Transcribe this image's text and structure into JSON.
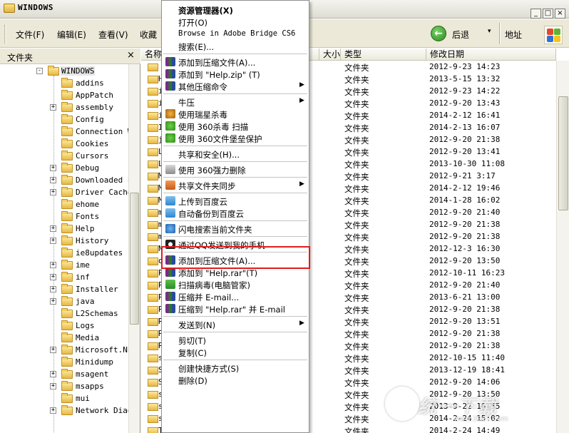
{
  "window": {
    "title": "WINDOWS",
    "minimize": "_",
    "maximize": "□",
    "close": "×"
  },
  "menubar": {
    "items": [
      "文件(F)",
      "编辑(E)",
      "查看(V)",
      "收藏"
    ],
    "back_label": "后退",
    "back_caret": "▾",
    "address_label": "地址"
  },
  "folders_pane": {
    "header": "文件夹",
    "close": "×",
    "root": "WINDOWS",
    "items": [
      {
        "name": "addins",
        "expander": ""
      },
      {
        "name": "AppPatch",
        "expander": ""
      },
      {
        "name": "assembly",
        "expander": "+"
      },
      {
        "name": "Config",
        "expander": ""
      },
      {
        "name": "Connection W",
        "expander": ""
      },
      {
        "name": "Cookies",
        "expander": ""
      },
      {
        "name": "Cursors",
        "expander": ""
      },
      {
        "name": "Debug",
        "expander": "+"
      },
      {
        "name": "Downloaded P",
        "expander": "+"
      },
      {
        "name": "Driver Cache",
        "expander": "+"
      },
      {
        "name": "ehome",
        "expander": ""
      },
      {
        "name": "Fonts",
        "expander": ""
      },
      {
        "name": "Help",
        "expander": "+"
      },
      {
        "name": "History",
        "expander": "+"
      },
      {
        "name": "ie8updates",
        "expander": ""
      },
      {
        "name": "ime",
        "expander": "+"
      },
      {
        "name": "inf",
        "expander": "+"
      },
      {
        "name": "Installer",
        "expander": "+"
      },
      {
        "name": "java",
        "expander": "+"
      },
      {
        "name": "L2Schemas",
        "expander": ""
      },
      {
        "name": "Logs",
        "expander": ""
      },
      {
        "name": "Media",
        "expander": ""
      },
      {
        "name": "Microsoft.NET",
        "expander": "+"
      },
      {
        "name": "Minidump",
        "expander": ""
      },
      {
        "name": "msagent",
        "expander": "+"
      },
      {
        "name": "msapps",
        "expander": "+"
      },
      {
        "name": "mui",
        "expander": ""
      },
      {
        "name": "Network Diag",
        "expander": "+"
      }
    ]
  },
  "file_list": {
    "columns": [
      "名称",
      "大小",
      "类型",
      "修改日期"
    ],
    "rows": [
      {
        "n": "",
        "type": "文件夹",
        "date": "2012-9-23 14:23"
      },
      {
        "n": "H",
        "type": "文件夹",
        "date": "2013-5-15 13:32"
      },
      {
        "n": "i",
        "type": "文件夹",
        "date": "2012-9-23 14:22"
      },
      {
        "n": "i",
        "type": "文件夹",
        "date": "2012-9-20 13:43"
      },
      {
        "n": "i",
        "type": "文件夹",
        "date": "2014-2-12 16:41"
      },
      {
        "n": "I",
        "type": "文件夹",
        "date": "2014-2-13 16:07"
      },
      {
        "n": "j",
        "type": "文件夹",
        "date": "2012-9-20 21:38"
      },
      {
        "n": "L",
        "type": "文件夹",
        "date": "2012-9-20 13:41"
      },
      {
        "n": "L",
        "type": "文件夹",
        "date": "2013-10-30 11:08"
      },
      {
        "n": "M",
        "type": "文件夹",
        "date": "2012-9-21 3:17"
      },
      {
        "n": "M",
        "type": "文件夹",
        "date": "2014-2-12 19:46"
      },
      {
        "n": "M",
        "type": "文件夹",
        "date": "2014-1-28 16:02"
      },
      {
        "n": "m",
        "type": "文件夹",
        "date": "2012-9-20 21:40"
      },
      {
        "n": "m",
        "type": "文件夹",
        "date": "2012-9-20 21:38"
      },
      {
        "n": "m",
        "type": "文件夹",
        "date": "2012-9-20 21:38"
      },
      {
        "n": "N",
        "type": "文件夹",
        "date": "2012-12-3 16:30"
      },
      {
        "n": "o",
        "type": "文件夹",
        "date": "2012-9-20 13:50"
      },
      {
        "n": "P",
        "type": "文件夹",
        "date": "2012-10-11 16:23"
      },
      {
        "n": "P",
        "type": "文件夹",
        "date": "2012-9-20 21:40"
      },
      {
        "n": "P",
        "type": "文件夹",
        "date": "2013-6-21 13:00"
      },
      {
        "n": "P",
        "type": "文件夹",
        "date": "2012-9-20 21:38"
      },
      {
        "n": "R",
        "type": "文件夹",
        "date": "2012-9-20 13:51"
      },
      {
        "n": "R",
        "type": "文件夹",
        "date": "2012-9-20 21:38"
      },
      {
        "n": "R",
        "type": "文件夹",
        "date": "2012-9-20 21:38"
      },
      {
        "n": "s",
        "type": "文件夹",
        "date": "2012-10-15 11:40"
      },
      {
        "n": "S",
        "type": "文件夹",
        "date": "2013-12-19 18:41"
      },
      {
        "n": "S",
        "type": "文件夹",
        "date": "2012-9-20 14:06"
      },
      {
        "n": "s",
        "type": "文件夹",
        "date": "2012-9-20 13:50"
      },
      {
        "n": "s",
        "type": "文件夹",
        "date": "2013-9-22 16:55"
      },
      {
        "n": "s",
        "type": "文件夹",
        "date": "2014-2-24 15:02"
      },
      {
        "n": "T",
        "type": "文件夹",
        "date": "2014-2-24 14:49"
      }
    ]
  },
  "context_menu": {
    "items": [
      {
        "label": "资源管理器(X)",
        "bold": true,
        "icon": "",
        "arrow": false
      },
      {
        "label": "打开(O)",
        "icon": "",
        "arrow": false
      },
      {
        "label": "Browse in Adobe Bridge CS6",
        "mono": true,
        "icon": "",
        "arrow": false
      },
      {
        "label": "搜索(E)...",
        "icon": "",
        "arrow": false
      },
      {
        "sep": true
      },
      {
        "label": "添加到压缩文件(A)...",
        "icon": "winrar-icon",
        "arrow": false
      },
      {
        "label": "添加到 \"Help.zip\" (T)",
        "icon": "winrar-icon",
        "arrow": false
      },
      {
        "label": "其他压缩命令",
        "icon": "winrar-icon",
        "arrow": true
      },
      {
        "sep": true
      },
      {
        "label": "牛压",
        "icon": "",
        "arrow": true
      },
      {
        "label": "使用瑞星杀毒",
        "icon": "rising-antivirus-icon",
        "arrow": false
      },
      {
        "label": "使用 360杀毒 扫描",
        "icon": "shield-360-icon",
        "arrow": false
      },
      {
        "label": "使用 360文件堡垒保护",
        "icon": "shield-360-icon",
        "arrow": false
      },
      {
        "sep": true
      },
      {
        "label": "共享和安全(H)...",
        "icon": "",
        "arrow": false
      },
      {
        "sep": true
      },
      {
        "label": "使用 360强力删除",
        "icon": "shredder-icon",
        "arrow": false
      },
      {
        "sep": true
      },
      {
        "label": "共享文件夹同步",
        "icon": "sync-folder-icon",
        "arrow": true
      },
      {
        "sep": true
      },
      {
        "label": "上传到百度云",
        "icon": "baidu-cloud-icon",
        "arrow": false
      },
      {
        "label": "自动备份到百度云",
        "icon": "baidu-cloud-icon",
        "arrow": false
      },
      {
        "sep": true
      },
      {
        "label": "闪电搜索当前文件夹",
        "icon": "flash-search-icon",
        "arrow": false
      },
      {
        "sep": true
      },
      {
        "label": "通过QQ发送到我的手机",
        "icon": "qq-icon",
        "arrow": false
      },
      {
        "sep": true
      },
      {
        "label": "添加到压缩文件(A)...",
        "icon": "winrar-icon",
        "arrow": false
      },
      {
        "label": "添加到 \"Help.rar\"(T)",
        "icon": "winrar-icon",
        "arrow": false
      },
      {
        "label": "扫描病毒(电脑管家)",
        "icon": "tencent-manager-icon",
        "arrow": false
      },
      {
        "label": "压缩并 E-mail...",
        "icon": "winrar-icon",
        "arrow": false
      },
      {
        "label": "压缩到 \"Help.rar\" 并 E-mail",
        "icon": "winrar-icon",
        "arrow": false
      },
      {
        "sep": true
      },
      {
        "label": "发送到(N)",
        "icon": "",
        "arrow": true
      },
      {
        "sep": true
      },
      {
        "label": "剪切(T)",
        "icon": "",
        "arrow": false
      },
      {
        "label": "复制(C)",
        "icon": "",
        "arrow": false
      },
      {
        "sep": true
      },
      {
        "label": "创建快捷方式(S)",
        "icon": "",
        "arrow": false
      },
      {
        "label": "删除(D)",
        "icon": "",
        "arrow": false
      }
    ]
  },
  "watermark": {
    "text": "统一下载",
    "url": "www.3987.com"
  },
  "colors": {
    "highlight": "#e11c1c",
    "chrome": "#ece9d8"
  }
}
